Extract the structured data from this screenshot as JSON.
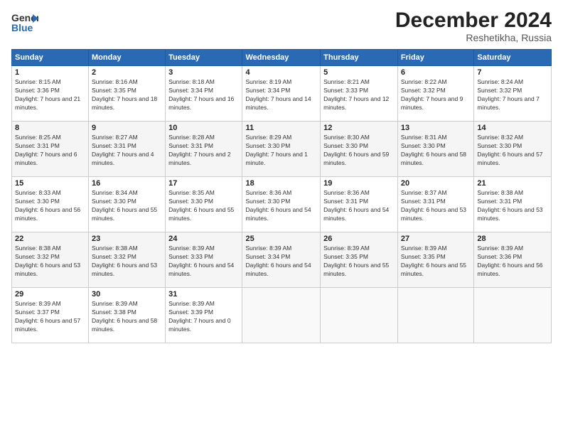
{
  "logo": {
    "line1": "General",
    "line2": "Blue"
  },
  "title": "December 2024",
  "location": "Reshetikha, Russia",
  "days_header": [
    "Sunday",
    "Monday",
    "Tuesday",
    "Wednesday",
    "Thursday",
    "Friday",
    "Saturday"
  ],
  "weeks": [
    [
      {
        "day": "1",
        "sunrise": "8:15 AM",
        "sunset": "3:36 PM",
        "daylight": "7 hours and 21 minutes."
      },
      {
        "day": "2",
        "sunrise": "8:16 AM",
        "sunset": "3:35 PM",
        "daylight": "7 hours and 18 minutes."
      },
      {
        "day": "3",
        "sunrise": "8:18 AM",
        "sunset": "3:34 PM",
        "daylight": "7 hours and 16 minutes."
      },
      {
        "day": "4",
        "sunrise": "8:19 AM",
        "sunset": "3:34 PM",
        "daylight": "7 hours and 14 minutes."
      },
      {
        "day": "5",
        "sunrise": "8:21 AM",
        "sunset": "3:33 PM",
        "daylight": "7 hours and 12 minutes."
      },
      {
        "day": "6",
        "sunrise": "8:22 AM",
        "sunset": "3:32 PM",
        "daylight": "7 hours and 9 minutes."
      },
      {
        "day": "7",
        "sunrise": "8:24 AM",
        "sunset": "3:32 PM",
        "daylight": "7 hours and 7 minutes."
      }
    ],
    [
      {
        "day": "8",
        "sunrise": "8:25 AM",
        "sunset": "3:31 PM",
        "daylight": "7 hours and 6 minutes."
      },
      {
        "day": "9",
        "sunrise": "8:27 AM",
        "sunset": "3:31 PM",
        "daylight": "7 hours and 4 minutes."
      },
      {
        "day": "10",
        "sunrise": "8:28 AM",
        "sunset": "3:31 PM",
        "daylight": "7 hours and 2 minutes."
      },
      {
        "day": "11",
        "sunrise": "8:29 AM",
        "sunset": "3:30 PM",
        "daylight": "7 hours and 1 minute."
      },
      {
        "day": "12",
        "sunrise": "8:30 AM",
        "sunset": "3:30 PM",
        "daylight": "6 hours and 59 minutes."
      },
      {
        "day": "13",
        "sunrise": "8:31 AM",
        "sunset": "3:30 PM",
        "daylight": "6 hours and 58 minutes."
      },
      {
        "day": "14",
        "sunrise": "8:32 AM",
        "sunset": "3:30 PM",
        "daylight": "6 hours and 57 minutes."
      }
    ],
    [
      {
        "day": "15",
        "sunrise": "8:33 AM",
        "sunset": "3:30 PM",
        "daylight": "6 hours and 56 minutes."
      },
      {
        "day": "16",
        "sunrise": "8:34 AM",
        "sunset": "3:30 PM",
        "daylight": "6 hours and 55 minutes."
      },
      {
        "day": "17",
        "sunrise": "8:35 AM",
        "sunset": "3:30 PM",
        "daylight": "6 hours and 55 minutes."
      },
      {
        "day": "18",
        "sunrise": "8:36 AM",
        "sunset": "3:30 PM",
        "daylight": "6 hours and 54 minutes."
      },
      {
        "day": "19",
        "sunrise": "8:36 AM",
        "sunset": "3:31 PM",
        "daylight": "6 hours and 54 minutes."
      },
      {
        "day": "20",
        "sunrise": "8:37 AM",
        "sunset": "3:31 PM",
        "daylight": "6 hours and 53 minutes."
      },
      {
        "day": "21",
        "sunrise": "8:38 AM",
        "sunset": "3:31 PM",
        "daylight": "6 hours and 53 minutes."
      }
    ],
    [
      {
        "day": "22",
        "sunrise": "8:38 AM",
        "sunset": "3:32 PM",
        "daylight": "6 hours and 53 minutes."
      },
      {
        "day": "23",
        "sunrise": "8:38 AM",
        "sunset": "3:32 PM",
        "daylight": "6 hours and 53 minutes."
      },
      {
        "day": "24",
        "sunrise": "8:39 AM",
        "sunset": "3:33 PM",
        "daylight": "6 hours and 54 minutes."
      },
      {
        "day": "25",
        "sunrise": "8:39 AM",
        "sunset": "3:34 PM",
        "daylight": "6 hours and 54 minutes."
      },
      {
        "day": "26",
        "sunrise": "8:39 AM",
        "sunset": "3:35 PM",
        "daylight": "6 hours and 55 minutes."
      },
      {
        "day": "27",
        "sunrise": "8:39 AM",
        "sunset": "3:35 PM",
        "daylight": "6 hours and 55 minutes."
      },
      {
        "day": "28",
        "sunrise": "8:39 AM",
        "sunset": "3:36 PM",
        "daylight": "6 hours and 56 minutes."
      }
    ],
    [
      {
        "day": "29",
        "sunrise": "8:39 AM",
        "sunset": "3:37 PM",
        "daylight": "6 hours and 57 minutes."
      },
      {
        "day": "30",
        "sunrise": "8:39 AM",
        "sunset": "3:38 PM",
        "daylight": "6 hours and 58 minutes."
      },
      {
        "day": "31",
        "sunrise": "8:39 AM",
        "sunset": "3:39 PM",
        "daylight": "7 hours and 0 minutes."
      },
      null,
      null,
      null,
      null
    ]
  ]
}
